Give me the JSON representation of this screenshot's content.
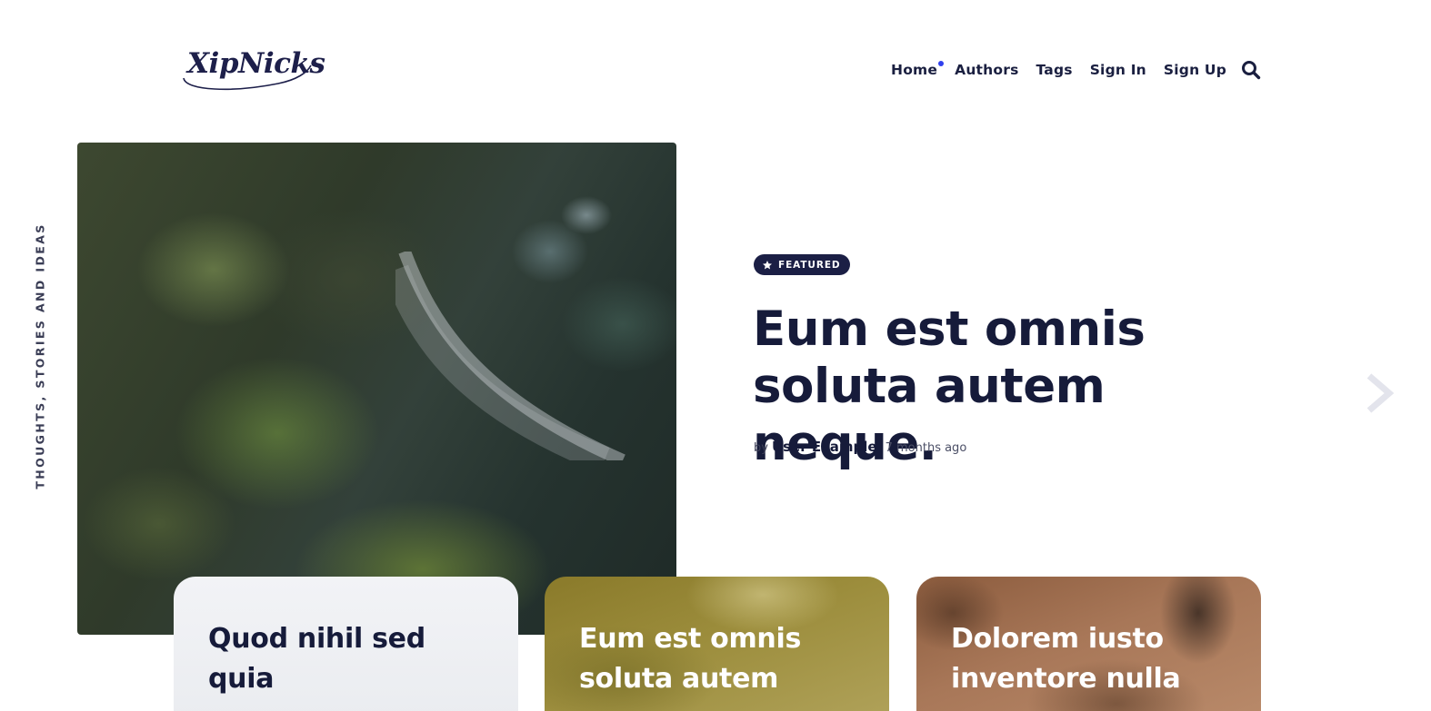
{
  "header": {
    "logo_text": "XipNicks",
    "nav": [
      {
        "label": "Home",
        "active": true
      },
      {
        "label": "Authors"
      },
      {
        "label": "Tags"
      },
      {
        "label": "Sign In"
      },
      {
        "label": "Sign Up"
      }
    ],
    "search_icon": "search-icon",
    "active_dot_color": "#3040ee"
  },
  "tagline": "THOUGHTS, STORIES AND IDEAS",
  "featured": {
    "badge": "FEATURED",
    "badge_icon": "star-icon",
    "title": "Eum est omnis soluta autem neque.",
    "by": "by",
    "author": "User Example",
    "time": "7 months ago"
  },
  "carousel": {
    "next_icon": "chevron-right-icon"
  },
  "cards": [
    {
      "title": "Quod nihil sed quia"
    },
    {
      "title": "Eum est omnis soluta autem"
    },
    {
      "title": "Dolorem iusto inventore nulla"
    }
  ],
  "colors": {
    "primary_text": "#161b3a",
    "badge_bg": "#1b1f45"
  }
}
